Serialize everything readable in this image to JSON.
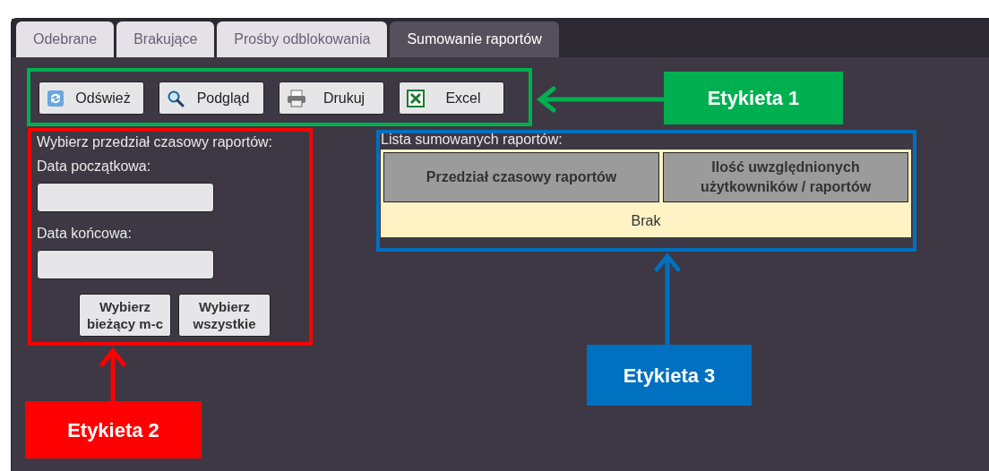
{
  "tabs": [
    {
      "label": "Odebrane",
      "selected": false
    },
    {
      "label": "Brakujące",
      "selected": false
    },
    {
      "label": "Prośby odblokowania",
      "selected": false
    },
    {
      "label": "Sumowanie raportów",
      "selected": true
    }
  ],
  "toolbar": [
    {
      "label": "Odśwież",
      "kind": "refresh"
    },
    {
      "label": "Podgląd",
      "kind": "search"
    },
    {
      "label": "Drukuj",
      "kind": "print"
    },
    {
      "label": "Excel",
      "kind": "excel"
    }
  ],
  "date_range": {
    "title": "Wybierz przedział czasowy raportów:",
    "start_label": "Data początkowa:",
    "end_label": "Data końcowa:",
    "buttons": [
      "Wybierz bieżący m-c",
      "Wybierz wszystkie"
    ]
  },
  "report_list": {
    "title": "Lista sumowanych raportów:",
    "columns": [
      "Przedział czasowy raportów",
      "Ilość uwzględnionych użytkowników / raportów"
    ],
    "empty_text": "Brak"
  },
  "annotations": [
    {
      "label": "Etykieta 1",
      "color": "#00b050"
    },
    {
      "label": "Etykieta 2",
      "color": "#ff0000"
    },
    {
      "label": "Etykieta 3",
      "color": "#0070c0"
    }
  ]
}
